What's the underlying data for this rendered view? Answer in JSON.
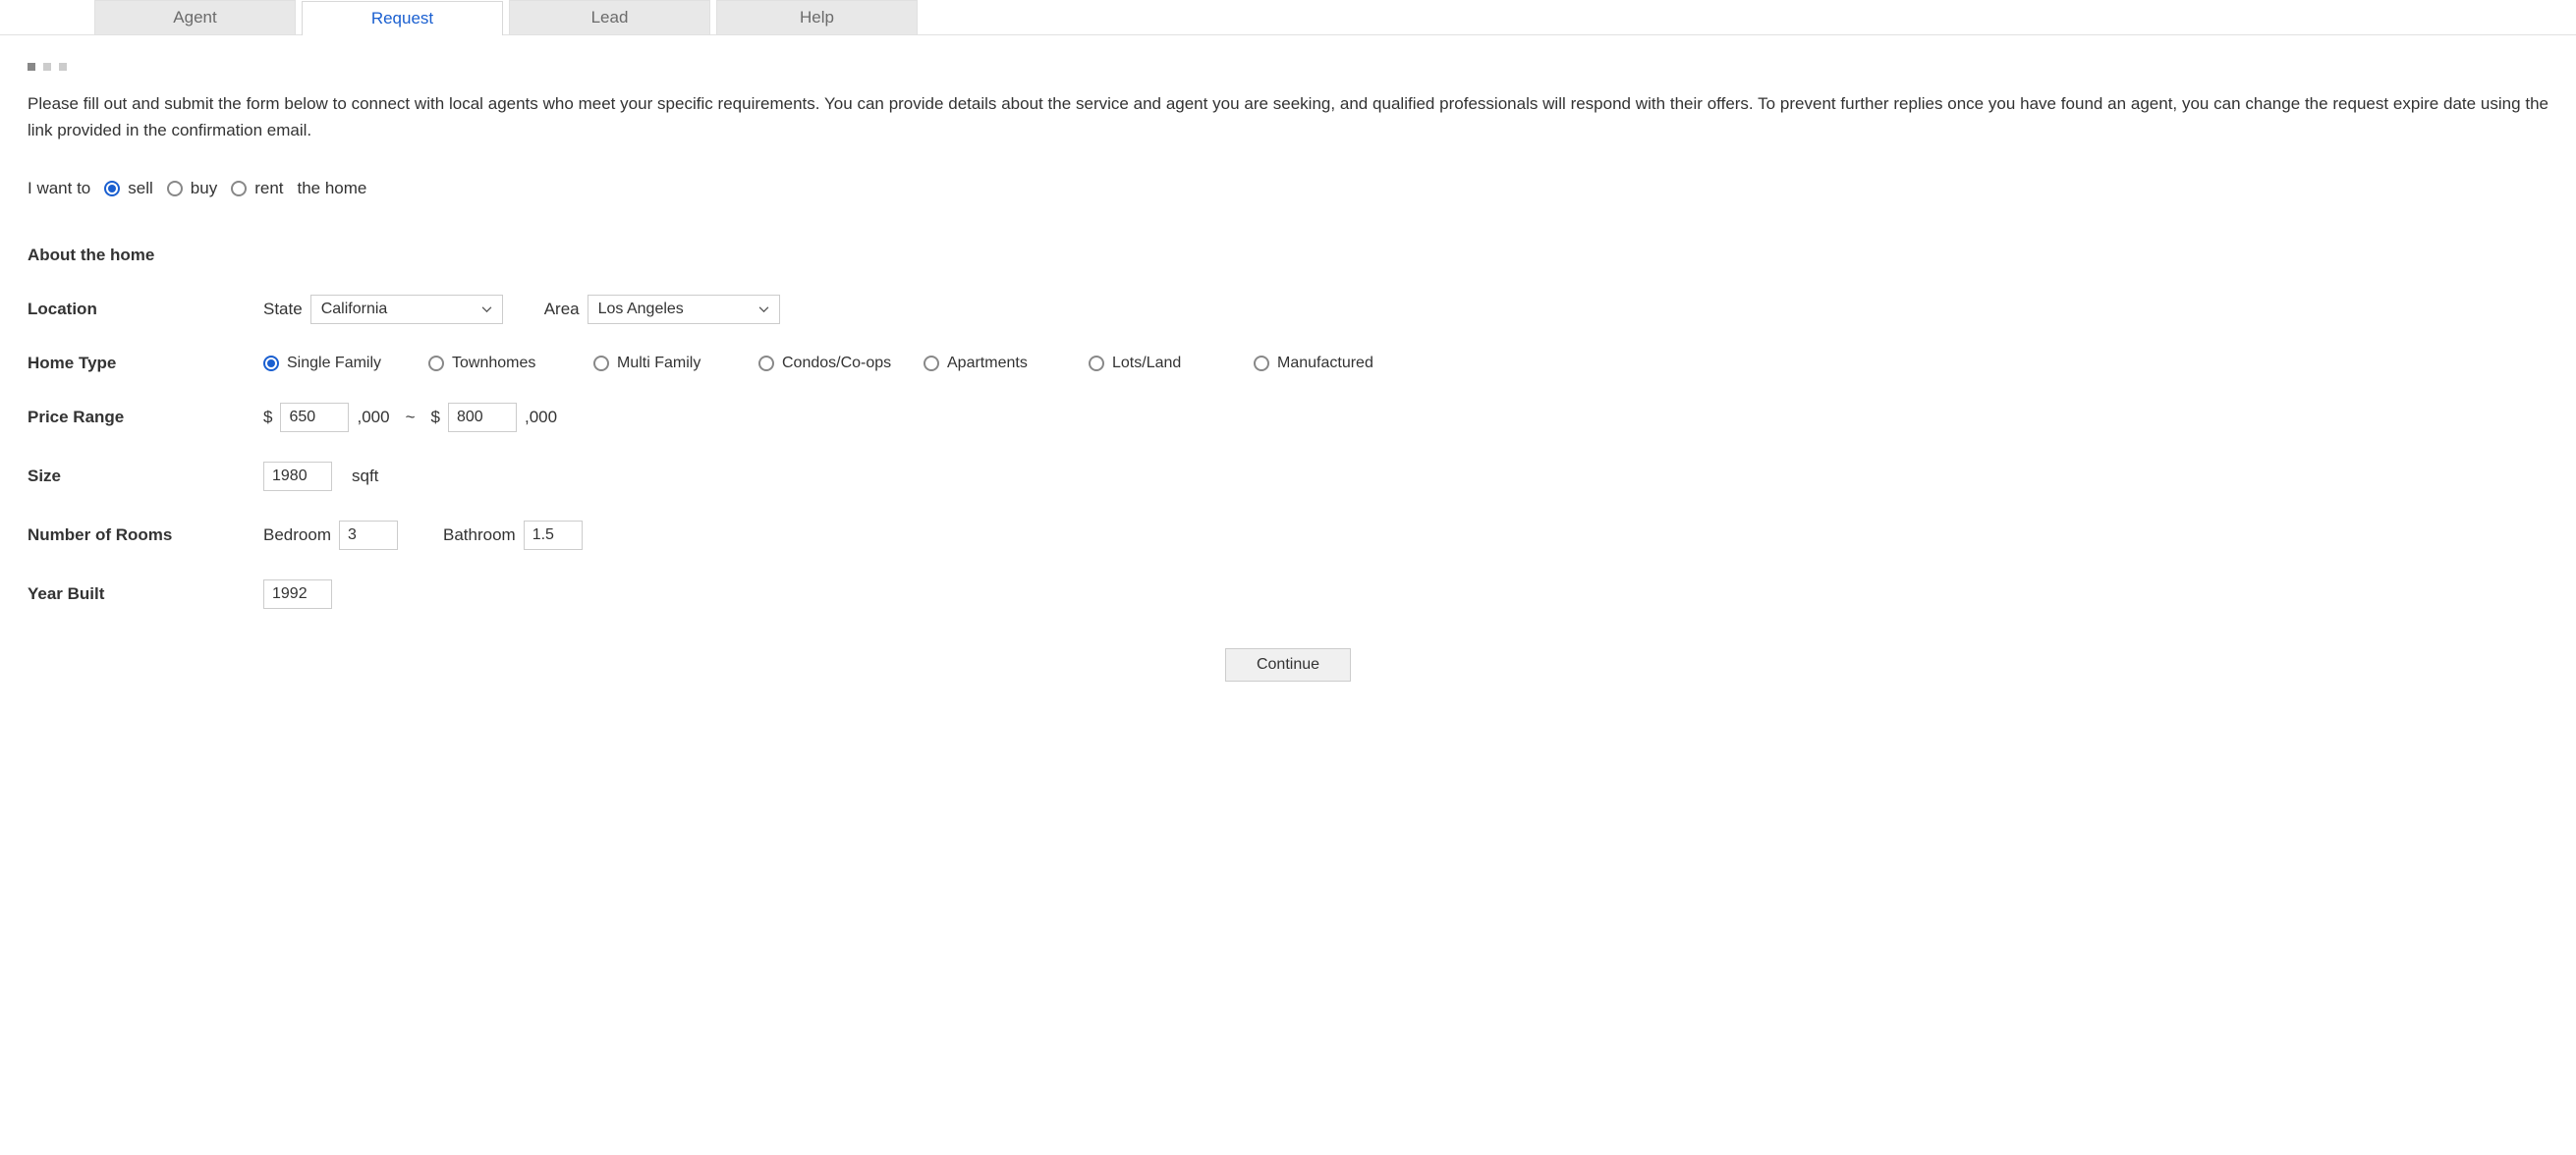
{
  "tabs": [
    {
      "label": "Agent",
      "active": false
    },
    {
      "label": "Request",
      "active": true
    },
    {
      "label": "Lead",
      "active": false
    },
    {
      "label": "Help",
      "active": false
    }
  ],
  "intro": "Please fill out and submit the form below to connect with local agents who meet your specific requirements. You can provide details about the service and agent you are seeking, and qualified professionals will respond with their offers. To prevent further replies once you have found an agent, you can change the request expire date using the link provided in the confirmation email.",
  "intent": {
    "prefix": "I want to",
    "suffix": "the home",
    "options": [
      {
        "label": "sell",
        "checked": true
      },
      {
        "label": "buy",
        "checked": false
      },
      {
        "label": "rent",
        "checked": false
      }
    ]
  },
  "section_title": "About the home",
  "location": {
    "label": "Location",
    "state_label": "State",
    "state_value": "California",
    "area_label": "Area",
    "area_value": "Los Angeles"
  },
  "home_type": {
    "label": "Home Type",
    "options": [
      {
        "label": "Single Family",
        "checked": true
      },
      {
        "label": "Townhomes",
        "checked": false
      },
      {
        "label": "Multi Family",
        "checked": false
      },
      {
        "label": "Condos/Co-ops",
        "checked": false
      },
      {
        "label": "Apartments",
        "checked": false
      },
      {
        "label": "Lots/Land",
        "checked": false
      },
      {
        "label": "Manufactured",
        "checked": false
      }
    ]
  },
  "price": {
    "label": "Price Range",
    "currency": "$",
    "min": "650",
    "max": "800",
    "thousands": ",000",
    "sep": "~"
  },
  "size": {
    "label": "Size",
    "value": "1980",
    "unit": "sqft"
  },
  "rooms": {
    "label": "Number of Rooms",
    "bedroom_label": "Bedroom",
    "bedroom_value": "3",
    "bathroom_label": "Bathroom",
    "bathroom_value": "1.5"
  },
  "year": {
    "label": "Year Built",
    "value": "1992"
  },
  "continue_label": "Continue"
}
